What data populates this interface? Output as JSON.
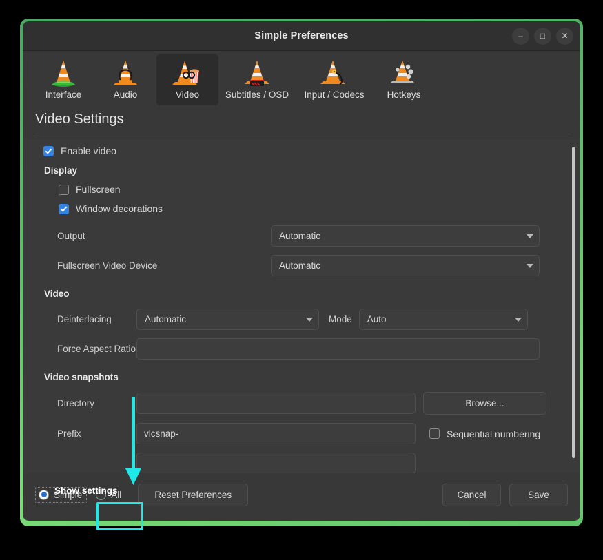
{
  "window": {
    "title": "Simple Preferences",
    "controls": [
      {
        "name": "minimize",
        "glyph": "–"
      },
      {
        "name": "maximize",
        "glyph": "□"
      },
      {
        "name": "close",
        "glyph": "✕"
      }
    ]
  },
  "tabs": [
    {
      "label": "Interface",
      "icon": "vlc-cone-interface-icon",
      "selected": false
    },
    {
      "label": "Audio",
      "icon": "vlc-cone-audio-icon",
      "selected": false
    },
    {
      "label": "Video",
      "icon": "vlc-cone-video-icon",
      "selected": true
    },
    {
      "label": "Subtitles / OSD",
      "icon": "vlc-cone-subtitles-icon",
      "selected": false
    },
    {
      "label": "Input / Codecs",
      "icon": "vlc-cone-input-icon",
      "selected": false
    },
    {
      "label": "Hotkeys",
      "icon": "vlc-cone-hotkeys-icon",
      "selected": false
    }
  ],
  "page": {
    "title": "Video Settings",
    "enable_video": {
      "label": "Enable video",
      "checked": true
    },
    "display": {
      "header": "Display",
      "fullscreen": {
        "label": "Fullscreen",
        "checked": false
      },
      "window_decorations": {
        "label": "Window decorations",
        "checked": true
      },
      "output": {
        "label": "Output",
        "value": "Automatic"
      },
      "fullscreen_video_device": {
        "label": "Fullscreen Video Device",
        "value": "Automatic"
      }
    },
    "video": {
      "header": "Video",
      "deinterlacing": {
        "label": "Deinterlacing",
        "value": "Automatic"
      },
      "mode": {
        "label": "Mode",
        "value": "Auto"
      },
      "force_aspect_ratio": {
        "label": "Force Aspect Ratio",
        "value": ""
      }
    },
    "snapshots": {
      "header": "Video snapshots",
      "directory": {
        "label": "Directory",
        "value": ""
      },
      "browse_label": "Browse...",
      "prefix": {
        "label": "Prefix",
        "value": "vlcsnap-"
      },
      "sequential_numbering": {
        "label": "Sequential numbering",
        "checked": false
      },
      "partial_field_value": ""
    }
  },
  "bottom": {
    "show_settings_label": "Show settings",
    "simple": {
      "label": "Simple",
      "selected": true
    },
    "all": {
      "label": "All",
      "selected": false
    },
    "reset_label": "Reset Preferences",
    "cancel_label": "Cancel",
    "save_label": "Save"
  },
  "annotation": {
    "color": "#21e8e8",
    "target": "All",
    "shape": "down-arrow-and-box"
  },
  "colors": {
    "window_border": "#63c96d",
    "accent_blue": "#3584e4",
    "panel_bg": "#3a3a3a",
    "chrome_bg": "#383838",
    "highlight_cyan": "#21e8e8"
  }
}
